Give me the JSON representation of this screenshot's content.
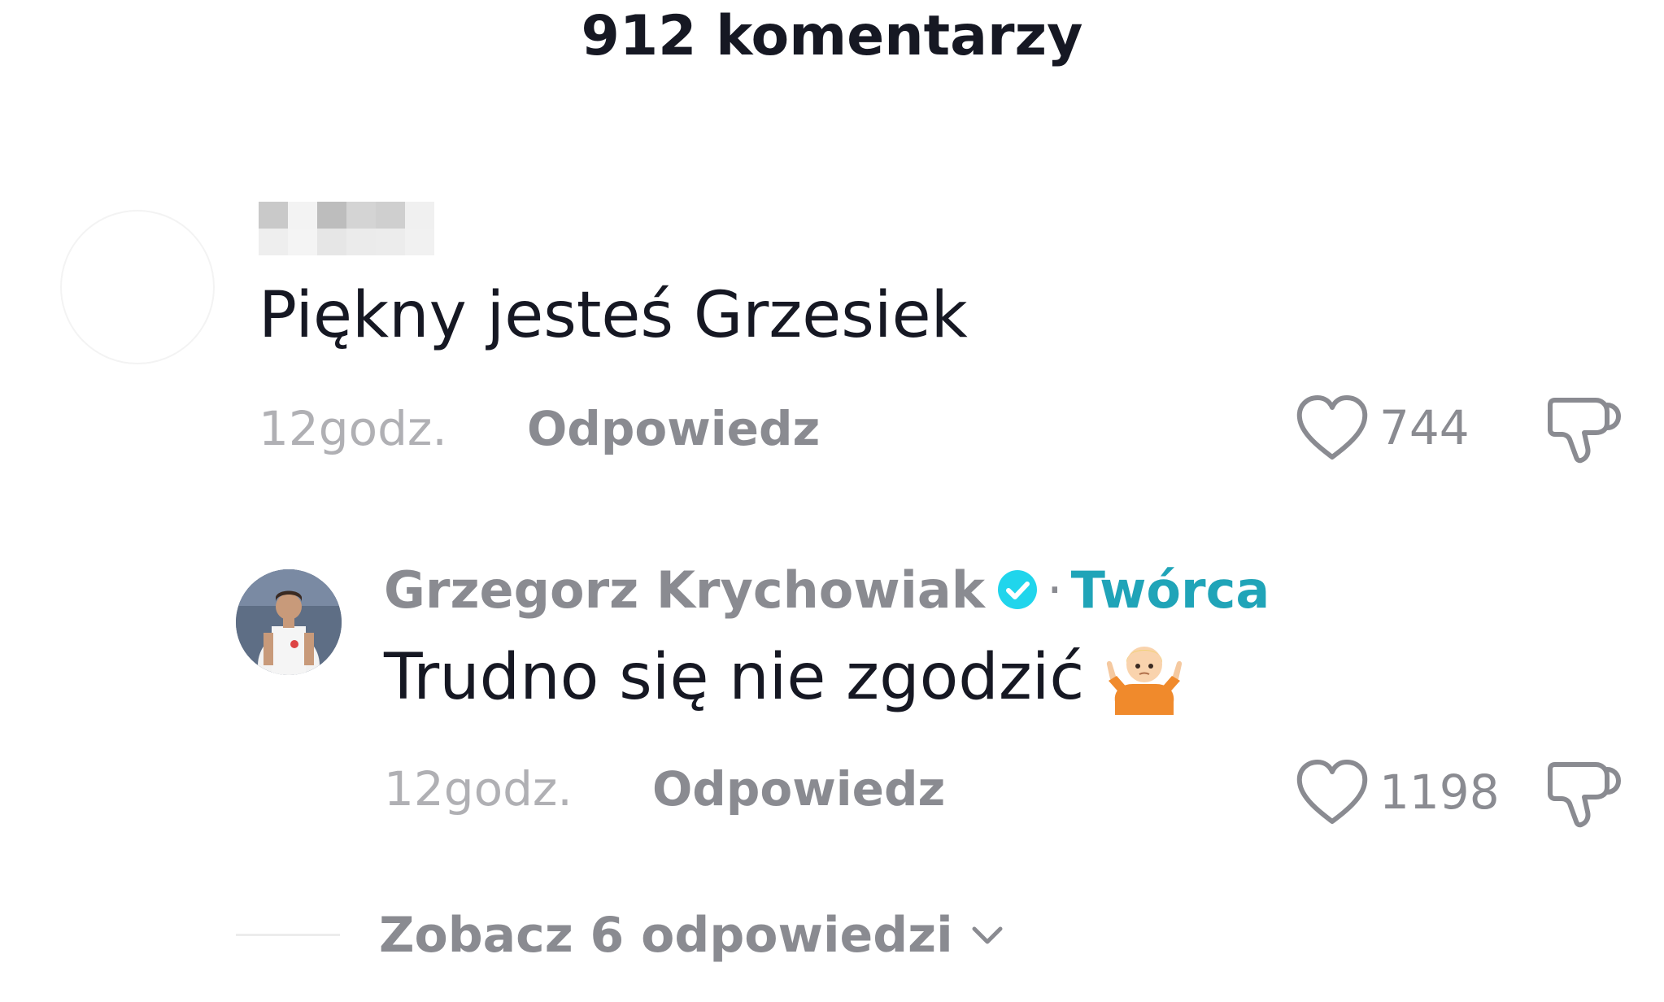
{
  "header": {
    "comment_count_label": "912 komentarzy"
  },
  "comments": [
    {
      "username": "",
      "username_hidden": true,
      "text": "Piękny jesteś Grzesiek",
      "time": "12godz.",
      "reply_label": "Odpowiedz",
      "likes": "744"
    }
  ],
  "reply": {
    "username": "Grzegorz Krychowiak",
    "verified": true,
    "separator": "·",
    "badge": "Twórca",
    "text": "Trudno się nie zgodzić",
    "emoji": "person-shrugging-emoji",
    "time": "12godz.",
    "reply_label": "Odpowiedz",
    "likes": "1198"
  },
  "view_replies": {
    "label": "Zobacz 6 odpowiedzi"
  },
  "colors": {
    "text_primary": "#161823",
    "text_secondary": "#8a8b91",
    "text_muted": "#b0b0b4",
    "creator_accent": "#20a4b8",
    "verified_blue": "#20d5ec"
  }
}
